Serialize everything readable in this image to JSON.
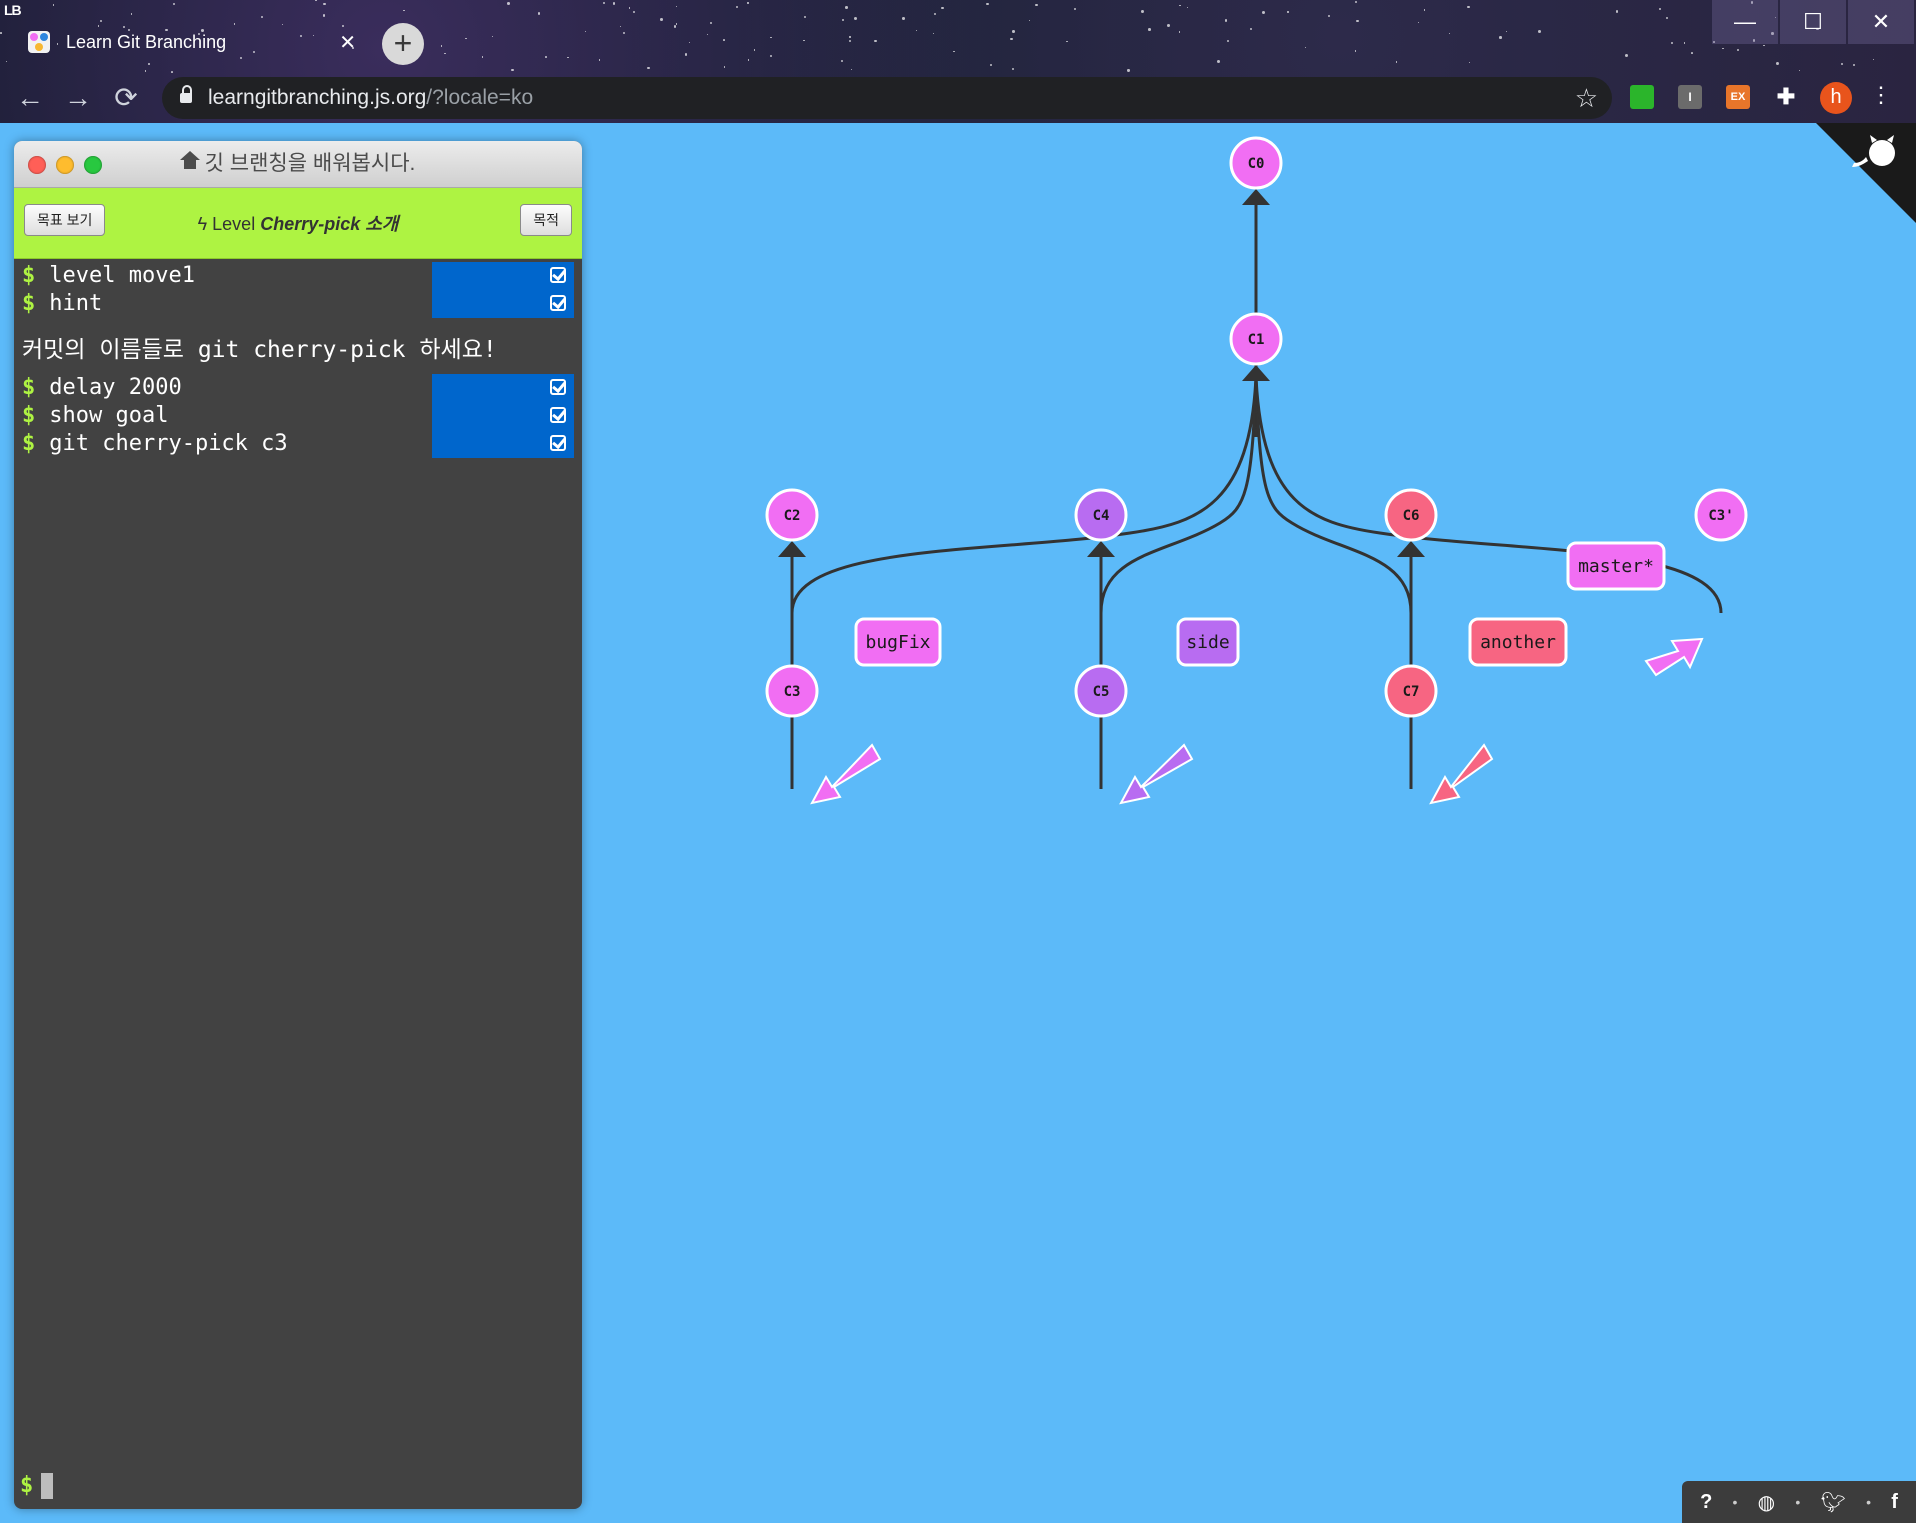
{
  "browser": {
    "tab_title": "Learn Git Branching",
    "tab_close": "✕",
    "new_tab": "+",
    "url_host": "learngitbranching.js.org",
    "url_path": "/?locale=ko",
    "profile_initial": "h",
    "ext_labels": [
      "",
      "I",
      "EX"
    ],
    "win_controls": [
      "—",
      "☐",
      "✕"
    ]
  },
  "terminal": {
    "title": "깃 브랜칭을 배워봅시다.",
    "goal_button": "목표 보기",
    "objective_button": "목적",
    "level_prefix": "Level ",
    "level_name": "Cherry-pick 소개",
    "commands_top": [
      "level move1",
      "hint"
    ],
    "hint_text": "커밋의 이름들로 git cherry-pick 하세요!",
    "commands_bottom": [
      "delay 2000",
      "show goal",
      "git cherry-pick c3"
    ],
    "prompt": "$"
  },
  "graph": {
    "commits": [
      "C0",
      "C1",
      "C2",
      "C3",
      "C4",
      "C5",
      "C6",
      "C7",
      "C3'"
    ],
    "branches": [
      "bugFix",
      "side",
      "another",
      "master*"
    ],
    "colors": {
      "pink": "#f16ef3",
      "purple": "#b86cf1",
      "red": "#f76582",
      "edge": "#333333",
      "bg": "#5cbaf9"
    }
  },
  "footer": {
    "items": [
      "?",
      "globe",
      "twitter",
      "f"
    ],
    "sep": "•"
  }
}
